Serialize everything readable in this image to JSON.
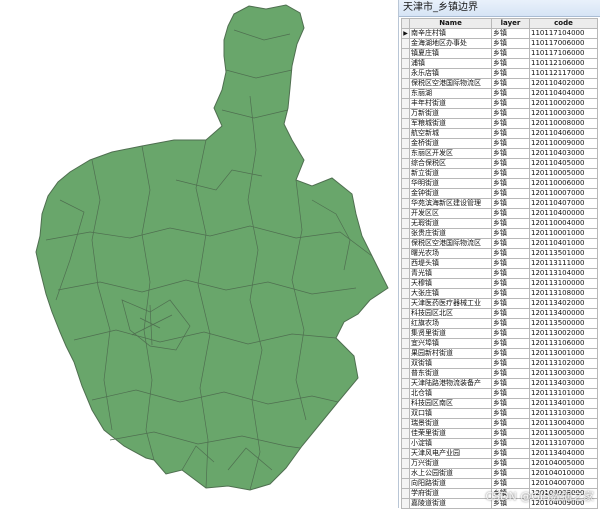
{
  "window": {
    "title": "天津市_乡镇边界"
  },
  "table": {
    "headers": [
      "Name",
      "layer",
      "code"
    ],
    "rows": [
      {
        "name": "南辛庄村镇",
        "layer": "乡镇",
        "code": "110117104000"
      },
      {
        "name": "金海湖地区办事处",
        "layer": "乡镇",
        "code": "110117006000"
      },
      {
        "name": "镇夏庄镇",
        "layer": "乡镇",
        "code": "110117106000"
      },
      {
        "name": "浦镇",
        "layer": "乡镇",
        "code": "110112106000"
      },
      {
        "name": "永乐店镇",
        "layer": "乡镇",
        "code": "110112117000"
      },
      {
        "name": "保税区空港国际物流区",
        "layer": "乡镇",
        "code": "120110402000"
      },
      {
        "name": "东丽湖",
        "layer": "乡镇",
        "code": "120110404000"
      },
      {
        "name": "丰年村街道",
        "layer": "乡镇",
        "code": "120110002000"
      },
      {
        "name": "万新街道",
        "layer": "乡镇",
        "code": "120110003000"
      },
      {
        "name": "军粮城街道",
        "layer": "乡镇",
        "code": "120110008000"
      },
      {
        "name": "航空新城",
        "layer": "乡镇",
        "code": "120110406000"
      },
      {
        "name": "金桥街道",
        "layer": "乡镇",
        "code": "120110009000"
      },
      {
        "name": "东丽区开发区",
        "layer": "乡镇",
        "code": "120110403000"
      },
      {
        "name": "综合保税区",
        "layer": "乡镇",
        "code": "120110405000"
      },
      {
        "name": "新立街道",
        "layer": "乡镇",
        "code": "120110005000"
      },
      {
        "name": "华明街道",
        "layer": "乡镇",
        "code": "120110006000"
      },
      {
        "name": "金钟街道",
        "layer": "乡镇",
        "code": "120110007000"
      },
      {
        "name": "华苑滨海新区建设管理",
        "layer": "乡镇",
        "code": "120110407000"
      },
      {
        "name": "开发区区",
        "layer": "乡镇",
        "code": "120110400000"
      },
      {
        "name": "无瑕街道",
        "layer": "乡镇",
        "code": "120110004000"
      },
      {
        "name": "张贵庄街道",
        "layer": "乡镇",
        "code": "120110001000"
      },
      {
        "name": "保税区空港国际物流区",
        "layer": "乡镇",
        "code": "120110401000"
      },
      {
        "name": "曙光农场",
        "layer": "乡镇",
        "code": "120113501000"
      },
      {
        "name": "西堤头镇",
        "layer": "乡镇",
        "code": "120113111000"
      },
      {
        "name": "青光镇",
        "layer": "乡镇",
        "code": "120113104000"
      },
      {
        "name": "天穆镇",
        "layer": "乡镇",
        "code": "120113100000"
      },
      {
        "name": "大张庄镇",
        "layer": "乡镇",
        "code": "120113108000"
      },
      {
        "name": "天津医药医疗器械工业",
        "layer": "乡镇",
        "code": "120113402000"
      },
      {
        "name": "科技园区北区",
        "layer": "乡镇",
        "code": "120113400000"
      },
      {
        "name": "红旗农场",
        "layer": "乡镇",
        "code": "120113500000"
      },
      {
        "name": "集贤里街道",
        "layer": "乡镇",
        "code": "120113002000"
      },
      {
        "name": "宜兴埠镇",
        "layer": "乡镇",
        "code": "120113106000"
      },
      {
        "name": "果园新村街道",
        "layer": "乡镇",
        "code": "120113001000"
      },
      {
        "name": "双街镇",
        "layer": "乡镇",
        "code": "120113102000"
      },
      {
        "name": "普东街道",
        "layer": "乡镇",
        "code": "120113003000"
      },
      {
        "name": "天津陆路港物流装备产",
        "layer": "乡镇",
        "code": "120113403000"
      },
      {
        "name": "北仓镇",
        "layer": "乡镇",
        "code": "120113101000"
      },
      {
        "name": "科技园区南区",
        "layer": "乡镇",
        "code": "120113401000"
      },
      {
        "name": "双口镇",
        "layer": "乡镇",
        "code": "120113103000"
      },
      {
        "name": "瑞景街道",
        "layer": "乡镇",
        "code": "120113004000"
      },
      {
        "name": "佳荣里街道",
        "layer": "乡镇",
        "code": "120113005000"
      },
      {
        "name": "小淀镇",
        "layer": "乡镇",
        "code": "120113107000"
      },
      {
        "name": "天津风电产业园",
        "layer": "乡镇",
        "code": "120113404000"
      },
      {
        "name": "万兴街道",
        "layer": "乡镇",
        "code": "120104005000"
      },
      {
        "name": "水上公园街道",
        "layer": "乡镇",
        "code": "120104010000"
      },
      {
        "name": "向阳路街道",
        "layer": "乡镇",
        "code": "120104007000"
      },
      {
        "name": "学府街道",
        "layer": "乡镇",
        "code": "120104008000"
      },
      {
        "name": "嘉陵道街道",
        "layer": "乡镇",
        "code": "120104009000"
      }
    ]
  },
  "watermark": {
    "text": "CSDN @GIS数据之家"
  },
  "colors": {
    "map_fill": "#69a66b",
    "map_stroke": "#4f6f50",
    "accent": "#1f4f9c"
  }
}
